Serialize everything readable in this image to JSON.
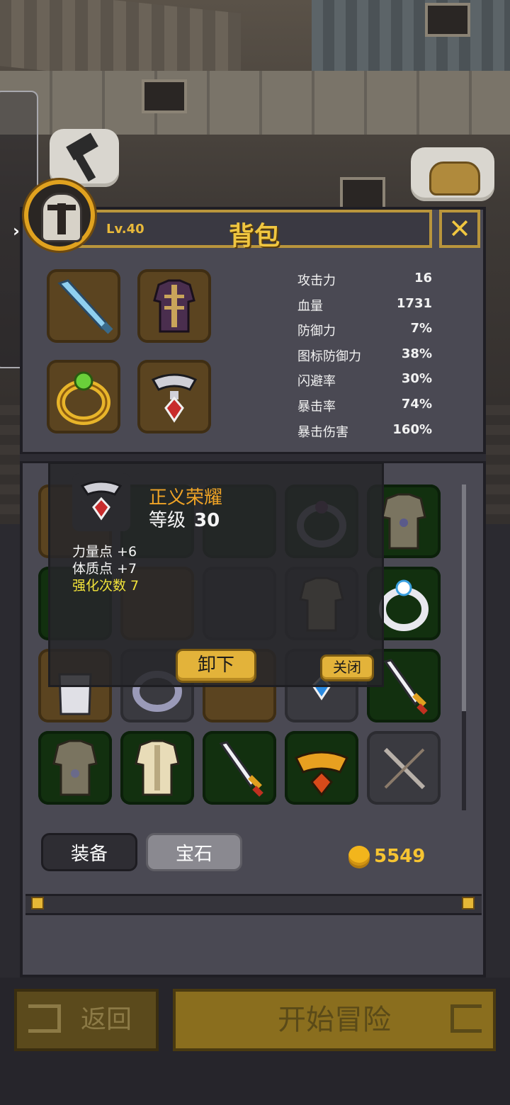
{
  "header": {
    "title": "背包",
    "level": "Lv.40"
  },
  "equipped": [
    {
      "icon": "dagger-icon",
      "slot": "weapon"
    },
    {
      "icon": "robe-armor-icon",
      "slot": "armor"
    },
    {
      "icon": "emerald-ring-icon",
      "slot": "ring"
    },
    {
      "icon": "ruby-necklace-icon",
      "slot": "necklace"
    }
  ],
  "stats": [
    {
      "label": "攻击力",
      "value": "16"
    },
    {
      "label": "血量",
      "value": "1731"
    },
    {
      "label": "防御力",
      "value": "7%"
    },
    {
      "label": "图标防御力",
      "value": "38%"
    },
    {
      "label": "闪避率",
      "value": "30%"
    },
    {
      "label": "暴击率",
      "value": "74%"
    },
    {
      "label": "暴击伤害",
      "value": "160%"
    }
  ],
  "popup": {
    "name": "正义荣耀",
    "level_label": "等级",
    "level_value": "30",
    "stat1": "力量点 +6",
    "stat2": "体质点 +7",
    "stat3": "强化次数 7",
    "unequip": "卸下",
    "close": "关闭"
  },
  "tabs": {
    "equip": "装备",
    "gem": "宝石"
  },
  "gold": "5549",
  "nav": {
    "back": "返回",
    "start": "开始冒险"
  },
  "colors": {
    "accent": "#f0c640",
    "gold": "#f6c432",
    "cell_green": "#12300f",
    "cell_brown": "#5b4420"
  }
}
